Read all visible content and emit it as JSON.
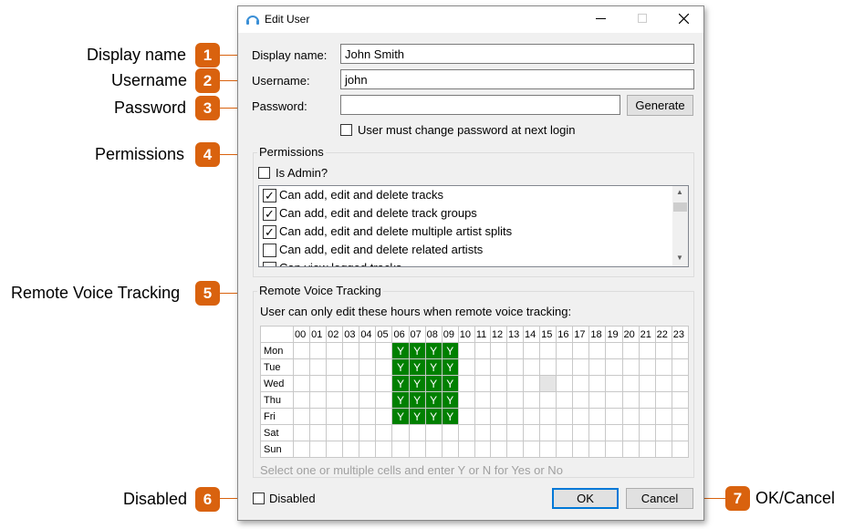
{
  "window": {
    "title": "Edit User",
    "icon": "headphones-icon"
  },
  "callouts": [
    {
      "n": "1",
      "label": "Display name"
    },
    {
      "n": "2",
      "label": "Username"
    },
    {
      "n": "3",
      "label": "Password"
    },
    {
      "n": "4",
      "label": "Permissions"
    },
    {
      "n": "5",
      "label": "Remote Voice Tracking"
    },
    {
      "n": "6",
      "label": "Disabled"
    },
    {
      "n": "7",
      "label": "OK/Cancel"
    }
  ],
  "form": {
    "display_name_label": "Display name:",
    "display_name_value": "John Smith",
    "username_label": "Username:",
    "username_value": "john",
    "password_label": "Password:",
    "password_value": "",
    "generate_label": "Generate",
    "must_change_label": "User must change password at next login",
    "must_change_checked": false
  },
  "permissions": {
    "title": "Permissions",
    "is_admin_label": "Is Admin?",
    "is_admin_checked": false,
    "items": [
      {
        "label": "Can add, edit and delete tracks",
        "checked": true
      },
      {
        "label": "Can add, edit and delete track groups",
        "checked": true
      },
      {
        "label": "Can add, edit and delete multiple artist splits",
        "checked": true
      },
      {
        "label": "Can add, edit and delete related artists",
        "checked": false
      },
      {
        "label": "Can view logged tracks",
        "checked": false
      }
    ]
  },
  "rvt": {
    "title": "Remote Voice Tracking",
    "instruction": "User can only edit these hours when remote voice tracking:",
    "hours": [
      "00",
      "01",
      "02",
      "03",
      "04",
      "05",
      "06",
      "07",
      "08",
      "09",
      "10",
      "11",
      "12",
      "13",
      "14",
      "15",
      "16",
      "17",
      "18",
      "19",
      "20",
      "21",
      "22",
      "23"
    ],
    "days": [
      "Mon",
      "Tue",
      "Wed",
      "Thu",
      "Fri",
      "Sat",
      "Sun"
    ],
    "allowed": {
      "Mon": [
        6,
        7,
        8,
        9
      ],
      "Tue": [
        6,
        7,
        8,
        9
      ],
      "Wed": [
        6,
        7,
        8,
        9
      ],
      "Thu": [
        6,
        7,
        8,
        9
      ],
      "Fri": [
        6,
        7,
        8,
        9
      ],
      "Sat": [],
      "Sun": []
    },
    "allowed_mark": "Y",
    "selected_cell": {
      "day": "Wed",
      "hour": "15"
    },
    "hint": "Select one or multiple cells and enter Y or N for Yes or No"
  },
  "footer": {
    "disabled_label": "Disabled",
    "disabled_checked": false,
    "ok_label": "OK",
    "cancel_label": "Cancel"
  },
  "colors": {
    "callout": "#d9620e",
    "allowed": "#008000",
    "ok_border": "#0078d7"
  }
}
